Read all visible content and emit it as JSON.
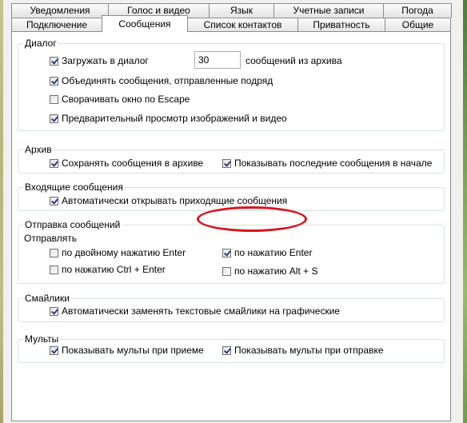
{
  "tabs_back": [
    {
      "label": "Уведомления"
    },
    {
      "label": "Голос и видео"
    },
    {
      "label": "Язык"
    },
    {
      "label": "Учетные записи"
    },
    {
      "label": "Погода"
    }
  ],
  "tabs_front": [
    {
      "label": "Подключение"
    },
    {
      "label": "Сообщения"
    },
    {
      "label": "Список контактов"
    },
    {
      "label": "Приватность"
    },
    {
      "label": "Общие"
    }
  ],
  "dialog": {
    "title": "Диалог",
    "load_label": "Загружать в диалог",
    "load_value": "30",
    "load_suffix": "сообщений из архива",
    "merge_label": "Объединять сообщения, отправленные подряд",
    "escape_label": "Сворачивать окно по Escape",
    "preview_label": "Предварительный просмотр изображений и видео"
  },
  "archive": {
    "title": "Архив",
    "save_label": "Сохранять сообщения в архиве",
    "show_last_label": "Показывать последние сообщения в начале"
  },
  "incoming": {
    "title": "Входящие сообщения",
    "auto_open_label": "Автоматически открывать приходящие сообщения"
  },
  "sending": {
    "title": "Отправка сообщений",
    "send_label": "Отправлять",
    "double_enter_label": "по двойному нажатию Enter",
    "enter_label": "по нажатию Enter",
    "ctrl_enter_label": "по нажатию Ctrl + Enter",
    "alt_s_label": "по нажатию Alt + S"
  },
  "smileys": {
    "title": "Смайлики",
    "replace_label": "Автоматически заменять текстовые смайлики на графические"
  },
  "cartoons": {
    "title": "Мульты",
    "on_receive_label": "Показывать мульты при приеме",
    "on_send_label": "Показывать мульты при отправке"
  }
}
